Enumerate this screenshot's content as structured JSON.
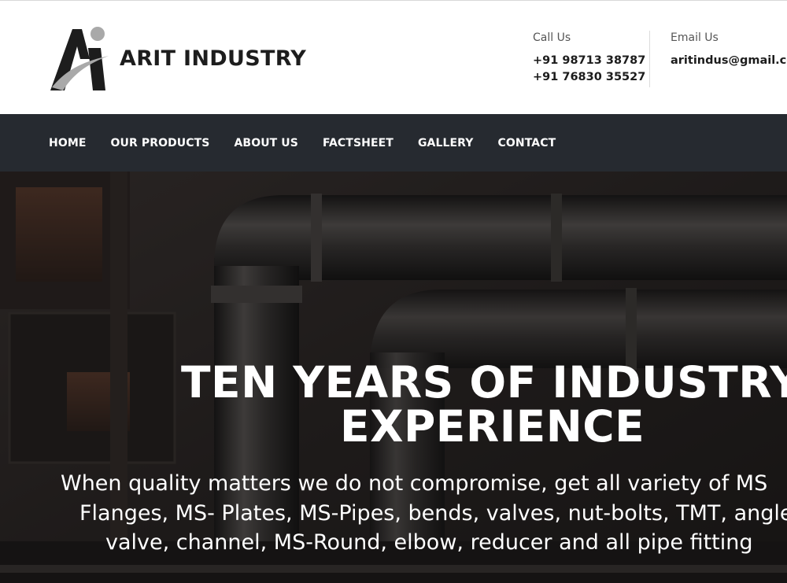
{
  "brand": {
    "logo_text": "ARIT INDUSTRY",
    "logo_icon": "ai-monogram-logo"
  },
  "contact": {
    "call_label": "Call Us",
    "phone_1": "+91 98713 38787",
    "phone_2": "+91 76830 35527",
    "email_label": "Email Us",
    "email": "aritindus@gmail.co"
  },
  "nav": {
    "items": [
      {
        "label": "HOME"
      },
      {
        "label": "OUR PRODUCTS"
      },
      {
        "label": "ABOUT US"
      },
      {
        "label": "FACTSHEET"
      },
      {
        "label": "GALLERY"
      },
      {
        "label": "CONTACT"
      }
    ]
  },
  "hero": {
    "title_line_1": "TEN YEARS OF INDUSTRY",
    "title_line_2": "EXPERIENCE",
    "subtitle_line_1": "When quality matters we do not compromise, get all variety of MS",
    "subtitle_line_2": "Flanges, MS- Plates, MS-Pipes, bends, valves, nut-bolts, TMT, angle",
    "subtitle_line_3": "valve, channel, MS-Round, elbow, reducer and all pipe fitting"
  },
  "colors": {
    "nav_background": "#262a30",
    "logo_dark": "#1d1d1d",
    "logo_grey": "#a9a9a9",
    "text_white": "#ffffff"
  }
}
